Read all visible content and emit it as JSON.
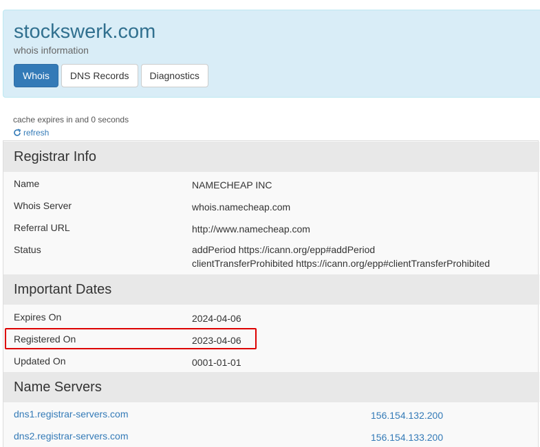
{
  "header": {
    "domain": "stockswerk.com",
    "subtitle": "whois information",
    "tabs": [
      {
        "label": "Whois",
        "active": true
      },
      {
        "label": "DNS Records",
        "active": false
      },
      {
        "label": "Diagnostics",
        "active": false
      }
    ]
  },
  "cache": {
    "text": "cache expires in and 0 seconds",
    "refresh_label": "refresh",
    "refresh_icon": "refresh-icon"
  },
  "registrar": {
    "title": "Registrar Info",
    "name_label": "Name",
    "name_value": "NAMECHEAP INC",
    "whois_label": "Whois Server",
    "whois_value": "whois.namecheap.com",
    "referral_label": "Referral URL",
    "referral_value": "http://www.namecheap.com",
    "status_label": "Status",
    "status_line1": "addPeriod https://icann.org/epp#addPeriod",
    "status_line2": "clientTransferProhibited https://icann.org/epp#clientTransferProhibited"
  },
  "dates": {
    "title": "Important Dates",
    "expires_label": "Expires On",
    "expires_value": "2024-04-06",
    "registered_label": "Registered On",
    "registered_value": "2023-04-06",
    "updated_label": "Updated On",
    "updated_value": "0001-01-01"
  },
  "nameservers": {
    "title": "Name Servers",
    "items": [
      {
        "host": "dns1.registrar-servers.com",
        "ip": "156.154.132.200"
      },
      {
        "host": "dns2.registrar-servers.com",
        "ip": "156.154.133.200"
      }
    ]
  },
  "colors": {
    "accent": "#337ab7",
    "header_bg": "#d9edf7",
    "highlight": "#dd0000"
  }
}
